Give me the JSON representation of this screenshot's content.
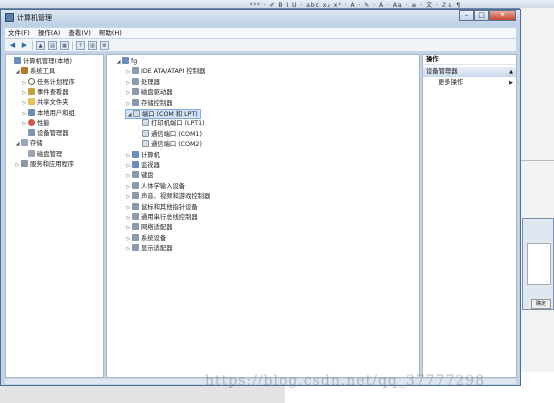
{
  "background": {
    "word_toolbar": "ᴬᴬᴬ · ✐ B I U · abc x₂ x² · A · ✎ · A · Aa · ≡ · 文 · ℤ↓ ¶",
    "watermark": "https://blog.csdn.net/qq_37777298",
    "dialog_button": "确定"
  },
  "window": {
    "title": "计算机管理",
    "controls": [
      "–",
      "□",
      "✕"
    ]
  },
  "menu": [
    "文件(F)",
    "操作(A)",
    "查看(V)",
    "帮助(H)"
  ],
  "toolbar_icons": [
    "back-arrow-icon",
    "forward-arrow-icon",
    "up-folder-icon",
    "show-hide-tree-icon",
    "properties-icon",
    "help-icon",
    "view-icon",
    "scan-icon"
  ],
  "left_tree": [
    {
      "label": "计算机管理(本地)",
      "indent": 0,
      "exp": "",
      "icon": "pc"
    },
    {
      "label": "系统工具",
      "indent": 1,
      "exp": "◢",
      "icon": "tool"
    },
    {
      "label": "任务计划程序",
      "indent": 2,
      "exp": "▷",
      "icon": "clock"
    },
    {
      "label": "事件查看器",
      "indent": 2,
      "exp": "▷",
      "icon": "event"
    },
    {
      "label": "共享文件夹",
      "indent": 2,
      "exp": "▷",
      "icon": "folder"
    },
    {
      "label": "本地用户和组",
      "indent": 2,
      "exp": "▷",
      "icon": "users"
    },
    {
      "label": "性能",
      "indent": 2,
      "exp": "▷",
      "icon": "perf"
    },
    {
      "label": "设备管理器",
      "indent": 2,
      "exp": "",
      "icon": "devmgr"
    },
    {
      "label": "存储",
      "indent": 1,
      "exp": "◢",
      "icon": "disk"
    },
    {
      "label": "磁盘管理",
      "indent": 2,
      "exp": "",
      "icon": "disk"
    },
    {
      "label": "服务和应用程序",
      "indent": 1,
      "exp": "▷",
      "icon": "svc"
    }
  ],
  "device_tree": [
    {
      "label": "fg",
      "indent": 0,
      "exp": "◢",
      "icon": "pc"
    },
    {
      "label": "IDE ATA/ATAPI 控制器",
      "indent": 1,
      "exp": "▷",
      "icon": "dev"
    },
    {
      "label": "处理器",
      "indent": 1,
      "exp": "▷",
      "icon": "dev"
    },
    {
      "label": "磁盘驱动器",
      "indent": 1,
      "exp": "▷",
      "icon": "dev"
    },
    {
      "label": "存储控制器",
      "indent": 1,
      "exp": "▷",
      "icon": "dev"
    },
    {
      "label": "端口 (COM 和 LPT)",
      "indent": 1,
      "exp": "◢",
      "icon": "port",
      "selected": true
    },
    {
      "label": "打印机端口 (LPT1)",
      "indent": 2,
      "exp": "",
      "icon": "port"
    },
    {
      "label": "通信端口 (COM1)",
      "indent": 2,
      "exp": "",
      "icon": "port"
    },
    {
      "label": "通信端口 (COM2)",
      "indent": 2,
      "exp": "",
      "icon": "port"
    },
    {
      "label": "计算机",
      "indent": 1,
      "exp": "▷",
      "icon": "pc"
    },
    {
      "label": "监视器",
      "indent": 1,
      "exp": "▷",
      "icon": "pc"
    },
    {
      "label": "键盘",
      "indent": 1,
      "exp": "▷",
      "icon": "dev"
    },
    {
      "label": "人体学输入设备",
      "indent": 1,
      "exp": "▷",
      "icon": "dev"
    },
    {
      "label": "声音、视频和游戏控制器",
      "indent": 1,
      "exp": "▷",
      "icon": "dev"
    },
    {
      "label": "鼠标和其他指针设备",
      "indent": 1,
      "exp": "▷",
      "icon": "dev"
    },
    {
      "label": "通用串行总线控制器",
      "indent": 1,
      "exp": "▷",
      "icon": "dev"
    },
    {
      "label": "网络适配器",
      "indent": 1,
      "exp": "▷",
      "icon": "dev"
    },
    {
      "label": "系统设备",
      "indent": 1,
      "exp": "▷",
      "icon": "dev"
    },
    {
      "label": "显示适配器",
      "indent": 1,
      "exp": "▷",
      "icon": "dev"
    }
  ],
  "actions": {
    "header": "操作",
    "group": "设备管理器",
    "more": "更多操作"
  }
}
